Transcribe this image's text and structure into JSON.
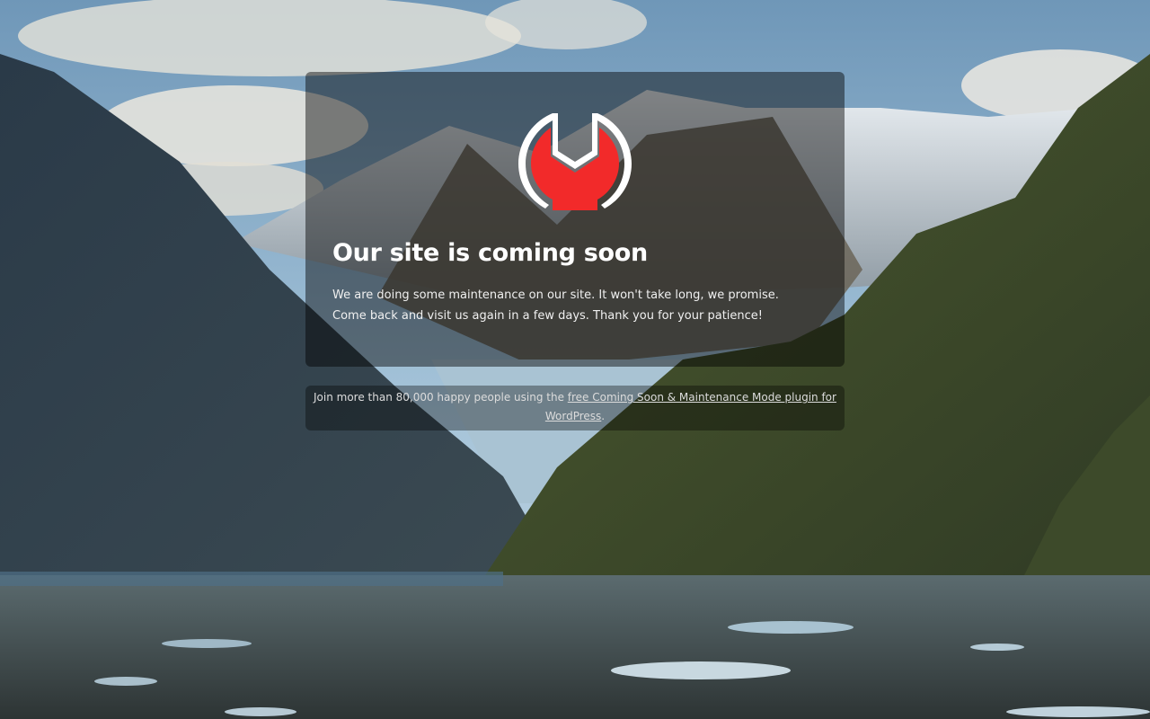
{
  "page": {
    "title": "Our site is coming soon",
    "message": "We are doing some maintenance on our site. It won't take long, we promise. Come back and visit us again in a few days. Thank you for your patience!"
  },
  "logo": {
    "icon": "wrench-logo-icon",
    "colors": {
      "fill": "#f22a2a",
      "outline": "#ffffff"
    }
  },
  "footer": {
    "prefix": "Join more than 80,000 happy people using the ",
    "link_text": "free Coming Soon & Maintenance Mode plugin for WordPress",
    "suffix": "."
  },
  "background": {
    "description_icon": "fjord-landscape-image"
  }
}
